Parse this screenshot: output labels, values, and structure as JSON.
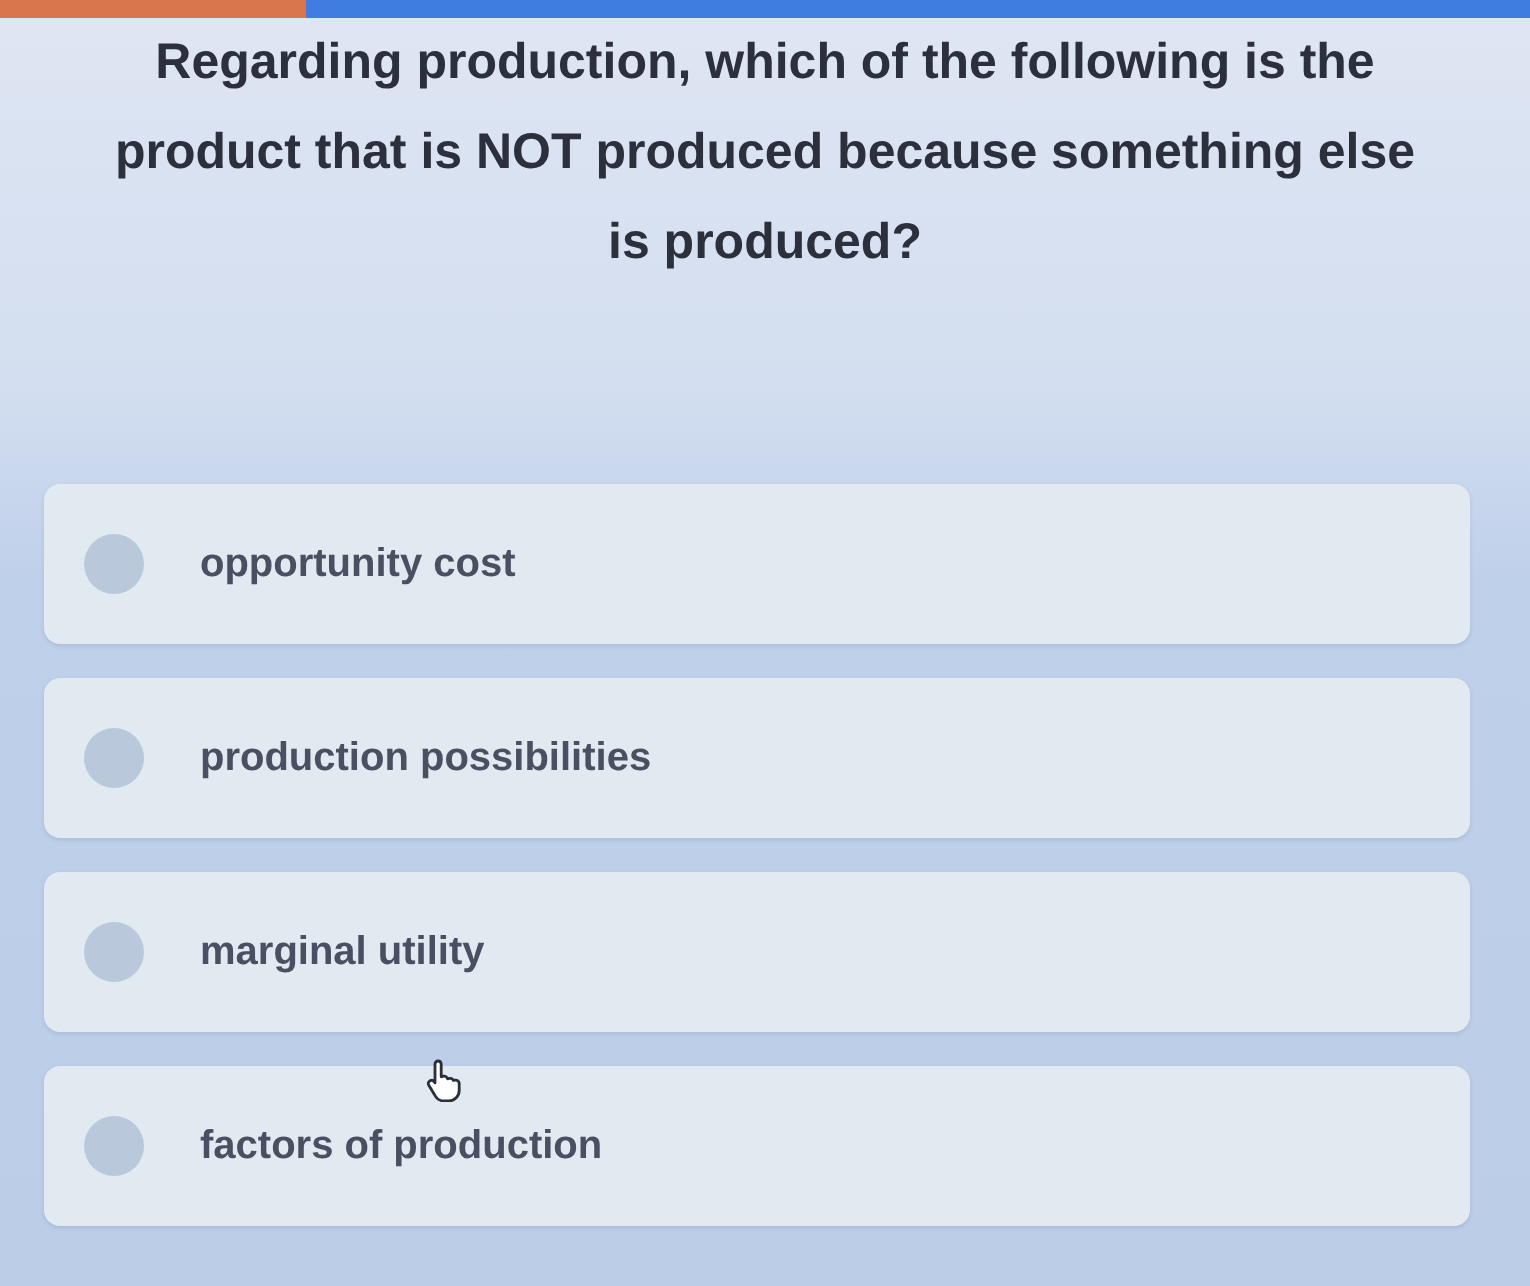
{
  "progress": {
    "level": 0.2
  },
  "question": {
    "text": "Regarding production, which of the following is the product that is NOT produced because something else is produced?"
  },
  "options": [
    {
      "label": "opportunity cost",
      "selected": false
    },
    {
      "label": "production possibilities",
      "selected": false
    },
    {
      "label": "marginal utility",
      "selected": false
    },
    {
      "label": "factors of production",
      "selected": false
    }
  ]
}
